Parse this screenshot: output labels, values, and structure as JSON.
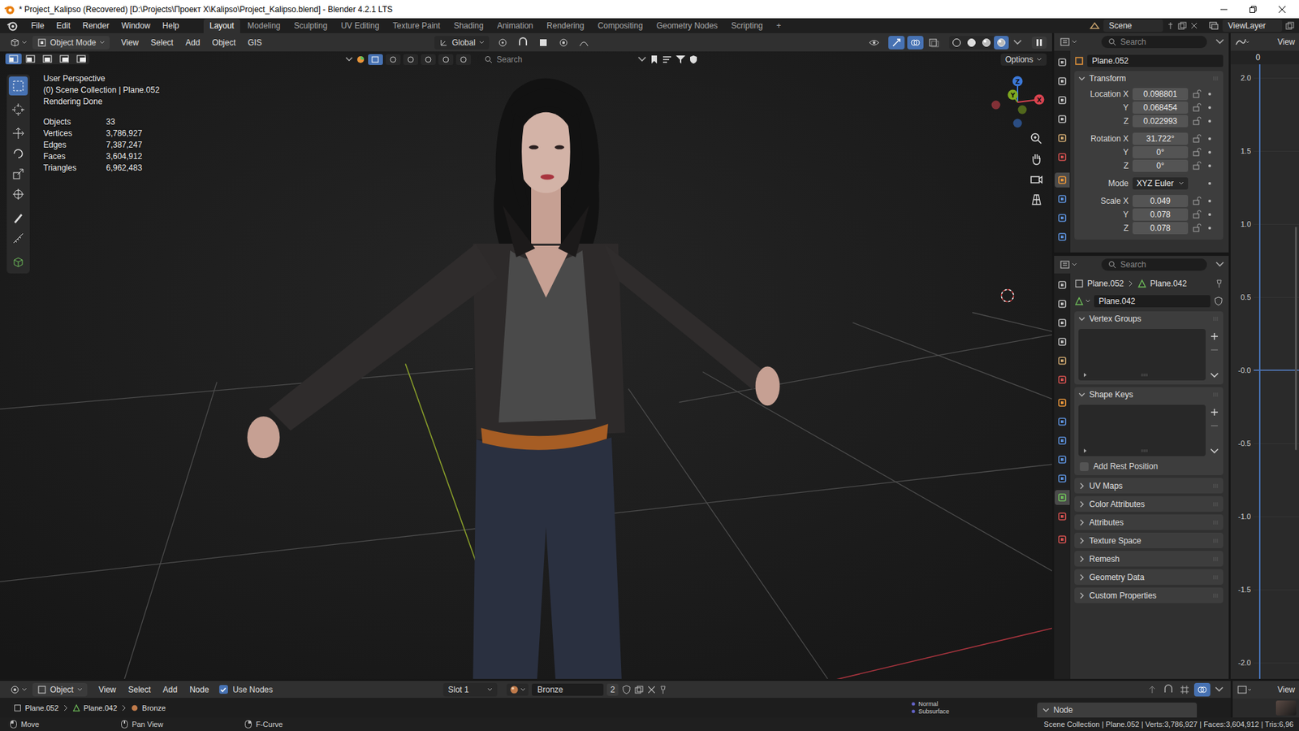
{
  "window": {
    "title": "* Project_Kalipso (Recovered) [D:\\Projects\\Проект X\\Kalipso\\Project_Kalipso.blend] - Blender 4.2.1 LTS"
  },
  "menu": [
    "File",
    "Edit",
    "Render",
    "Window",
    "Help"
  ],
  "workspaces": [
    {
      "label": "Layout",
      "selected": true
    },
    {
      "label": "Modeling",
      "selected": false
    },
    {
      "label": "Sculpting",
      "selected": false
    },
    {
      "label": "UV Editing",
      "selected": false
    },
    {
      "label": "Texture Paint",
      "selected": false
    },
    {
      "label": "Shading",
      "selected": false
    },
    {
      "label": "Animation",
      "selected": false
    },
    {
      "label": "Rendering",
      "selected": false
    },
    {
      "label": "Compositing",
      "selected": false
    },
    {
      "label": "Geometry Nodes",
      "selected": false
    },
    {
      "label": "Scripting",
      "selected": false
    }
  ],
  "add_workspace": "+",
  "scene": "Scene",
  "view_layer": "ViewLayer",
  "viewport": {
    "mode": "Object Mode",
    "menus": [
      "View",
      "Select",
      "Add",
      "Object",
      "GIS"
    ],
    "orientation": "Global",
    "search_placeholder": "Search",
    "options": "Options",
    "select_modes": [
      {
        "selected": true
      },
      {
        "selected": false
      },
      {
        "selected": false
      },
      {
        "selected": false
      },
      {
        "selected": false
      }
    ],
    "shading": [
      {
        "selected": false
      },
      {
        "selected": false
      },
      {
        "selected": false
      },
      {
        "selected": true
      }
    ],
    "tools": [
      {
        "selected": true
      },
      {
        "selected": false
      },
      {
        "selected": false
      },
      {
        "selected": false
      },
      {
        "selected": false
      },
      {
        "selected": false
      },
      {
        "selected": false
      },
      {
        "selected": false
      },
      {
        "selected": false
      }
    ],
    "info": [
      "User Perspective",
      "(0) Scene Collection | Plane.052",
      "Rendering Done"
    ],
    "stats": [
      {
        "label": "Objects",
        "value": "33"
      },
      {
        "label": "Vertices",
        "value": "3,786,927"
      },
      {
        "label": "Edges",
        "value": "7,387,247"
      },
      {
        "label": "Faces",
        "value": "3,604,912"
      },
      {
        "label": "Triangles",
        "value": "6,962,483"
      }
    ],
    "gizmo": [
      {
        "label": "Z",
        "color": "#3b78d8"
      },
      {
        "label": "Y",
        "color": "#7fa81f"
      },
      {
        "label": "X",
        "color": "#d9434f"
      }
    ]
  },
  "object_properties": {
    "search_placeholder": "Search",
    "object_name": "Plane.052",
    "tabs": [
      {
        "selected": false
      },
      {
        "selected": false
      },
      {
        "selected": false
      },
      {
        "selected": false
      },
      {
        "selected": false
      },
      {
        "selected": false
      },
      {
        "selected": true
      },
      {
        "selected": false
      },
      {
        "selected": false
      },
      {
        "selected": false
      }
    ],
    "panel": {
      "label": "Transform",
      "expanded": true
    },
    "groups": [
      {
        "rows": [
          {
            "label": "Location X",
            "value": "0.098801",
            "kind": "number"
          },
          {
            "label": "Y",
            "value": "0.068454",
            "kind": "number"
          },
          {
            "label": "Z",
            "value": "0.022993",
            "kind": "number"
          }
        ]
      },
      {
        "rows": [
          {
            "label": "Rotation X",
            "value": "31.722°",
            "kind": "number"
          },
          {
            "label": "Y",
            "value": "0°",
            "kind": "number"
          },
          {
            "label": "Z",
            "value": "0°",
            "kind": "number"
          }
        ]
      },
      {
        "rows": [
          {
            "label": "Mode",
            "value": "XYZ Euler",
            "kind": "dropdown"
          }
        ]
      },
      {
        "rows": [
          {
            "label": "Scale X",
            "value": "0.049",
            "kind": "number"
          },
          {
            "label": "Y",
            "value": "0.078",
            "kind": "number"
          },
          {
            "label": "Z",
            "value": "0.078",
            "kind": "number"
          }
        ]
      }
    ]
  },
  "data_properties": {
    "search_placeholder": "Search",
    "breadcrumb": [
      "Plane.052",
      "Plane.042"
    ],
    "mesh_name": "Plane.042",
    "tabs": [
      {
        "selected": false
      },
      {
        "selected": false
      },
      {
        "selected": false
      },
      {
        "selected": false
      },
      {
        "selected": false
      },
      {
        "selected": false
      },
      {
        "selected": false
      },
      {
        "selected": false
      },
      {
        "selected": false
      },
      {
        "selected": false
      },
      {
        "selected": false
      },
      {
        "selected": true
      },
      {
        "selected": false
      },
      {
        "selected": false
      }
    ],
    "list_panels": [
      {
        "label": "Vertex Groups",
        "expanded": true
      },
      {
        "label": "Shape Keys",
        "expanded": true
      }
    ],
    "rest_position": {
      "label": "Add Rest Position",
      "checked": false
    },
    "collapsed_panels": [
      {
        "label": "UV Maps",
        "expanded": false
      },
      {
        "label": "Color Attributes",
        "expanded": false
      },
      {
        "label": "Attributes",
        "expanded": false
      },
      {
        "label": "Texture Space",
        "expanded": false
      },
      {
        "label": "Remesh",
        "expanded": false
      },
      {
        "label": "Geometry Data",
        "expanded": false
      },
      {
        "label": "Custom Properties",
        "expanded": false
      }
    ]
  },
  "graph_editor": {
    "view": "View",
    "frame": "0",
    "ticks": [
      {
        "label": "2.0",
        "highlighted": false
      },
      {
        "label": "1.5",
        "highlighted": false
      },
      {
        "label": "1.0",
        "highlighted": false
      },
      {
        "label": "0.5",
        "highlighted": false
      },
      {
        "label": "-0.0",
        "highlighted": true
      },
      {
        "label": "-0.5",
        "highlighted": false
      },
      {
        "label": "-1.0",
        "highlighted": false
      },
      {
        "label": "-1.5",
        "highlighted": false
      },
      {
        "label": "-2.0",
        "highlighted": false
      }
    ]
  },
  "node_editor": {
    "type": "Object",
    "menus": [
      "View",
      "Select",
      "Add",
      "Node"
    ],
    "use_nodes": {
      "label": "Use Nodes",
      "checked": true
    },
    "slot": "Slot 1",
    "material": "Bronze",
    "users": "2",
    "breadcrumb": [
      "Plane.052",
      "Plane.042",
      "Bronze"
    ],
    "preview": [
      "Normal",
      "Subsurface"
    ],
    "sidebar_panel": "Node",
    "corner_view": "View"
  },
  "status_bar": {
    "hints": [
      "Move",
      "Pan View",
      "F-Curve"
    ],
    "info": "Scene Collection | Plane.052 | Verts:3,786,927 | Faces:3,604,912 | Tris:6,96"
  }
}
